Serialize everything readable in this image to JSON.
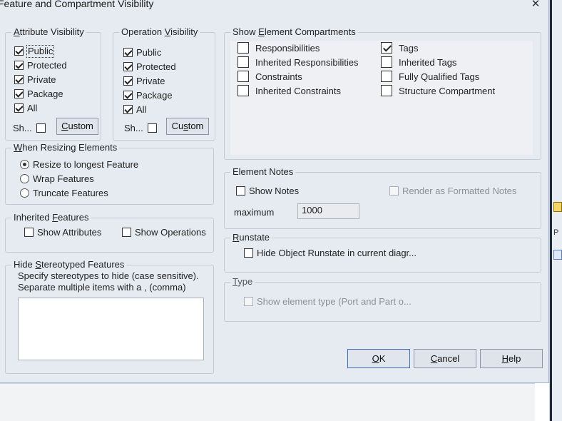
{
  "dialog": {
    "title": "Feature and Compartment Visibility",
    "close_glyph": "✕"
  },
  "attribute_visibility": {
    "legend_pre": "",
    "legend_u": "A",
    "legend_post": "ttribute Visibility",
    "items": [
      {
        "label": "Public",
        "checked": true
      },
      {
        "label": "Protected",
        "checked": true
      },
      {
        "label": "Private",
        "checked": true
      },
      {
        "label": "Package",
        "checked": true
      },
      {
        "label": "All",
        "checked": true
      }
    ],
    "show_label": "Sh...",
    "custom_pre": "",
    "custom_u": "C",
    "custom_post": "ustom"
  },
  "operation_visibility": {
    "legend_pre": "Operation ",
    "legend_u": "V",
    "legend_post": "isibility",
    "items": [
      {
        "label": "Public",
        "checked": true
      },
      {
        "label": "Protected",
        "checked": true
      },
      {
        "label": "Private",
        "checked": true
      },
      {
        "label": "Package",
        "checked": true
      },
      {
        "label": "All",
        "checked": true
      }
    ],
    "show_label": "Sh...",
    "custom_pre": "Cu",
    "custom_u": "s",
    "custom_post": "tom"
  },
  "compartments": {
    "legend_pre": "Show ",
    "legend_u": "E",
    "legend_post": "lement Compartments",
    "left": [
      {
        "label": "Responsibilities",
        "checked": false
      },
      {
        "label": "Inherited Responsibilities",
        "checked": false
      },
      {
        "label": "Constraints",
        "checked": false
      },
      {
        "label": "Inherited Constraints",
        "checked": false
      }
    ],
    "right": [
      {
        "label": "Tags",
        "checked": true
      },
      {
        "label": "Inherited Tags",
        "checked": false
      },
      {
        "label": "Fully Qualified Tags",
        "checked": false
      },
      {
        "label": "Structure Compartment",
        "checked": false
      }
    ]
  },
  "resizing": {
    "legend_pre": "",
    "legend_u": "W",
    "legend_post": "hen Resizing Elements",
    "options": [
      {
        "label": "Resize to longest Feature",
        "selected": true
      },
      {
        "label": "Wrap Features",
        "selected": false
      },
      {
        "label": "Truncate Features",
        "selected": false
      }
    ]
  },
  "inherited": {
    "legend_pre": "Inherited ",
    "legend_u": "F",
    "legend_post": "eatures",
    "show_attributes": "Show Attributes",
    "show_operations": "Show Operations"
  },
  "hide_stereotyped": {
    "legend_pre": "Hide ",
    "legend_u": "S",
    "legend_post": "tereotyped Features",
    "description": "Specify stereotypes to hide (case sensitive). Separate multiple items with a , (comma)",
    "value": ""
  },
  "element_notes": {
    "legend": "Element Notes",
    "show_notes": "Show Notes",
    "render_formatted": "Render as Formatted Notes",
    "maximum_label": "maximum",
    "maximum_value": "1000"
  },
  "runstate": {
    "legend_pre": "",
    "legend_u": "R",
    "legend_post": "unstate",
    "hide_label": "Hide Object Runstate in current diagr..."
  },
  "type": {
    "legend_pre": "",
    "legend_u": "T",
    "legend_post": "ype",
    "show_type": "Show element type (Port and Part o..."
  },
  "buttons": {
    "ok_u": "O",
    "ok_post": "K",
    "cancel_u": "C",
    "cancel_post": "ancel",
    "help_u": "H",
    "help_post": "elp"
  },
  "background": {
    "side_letter": "P"
  }
}
